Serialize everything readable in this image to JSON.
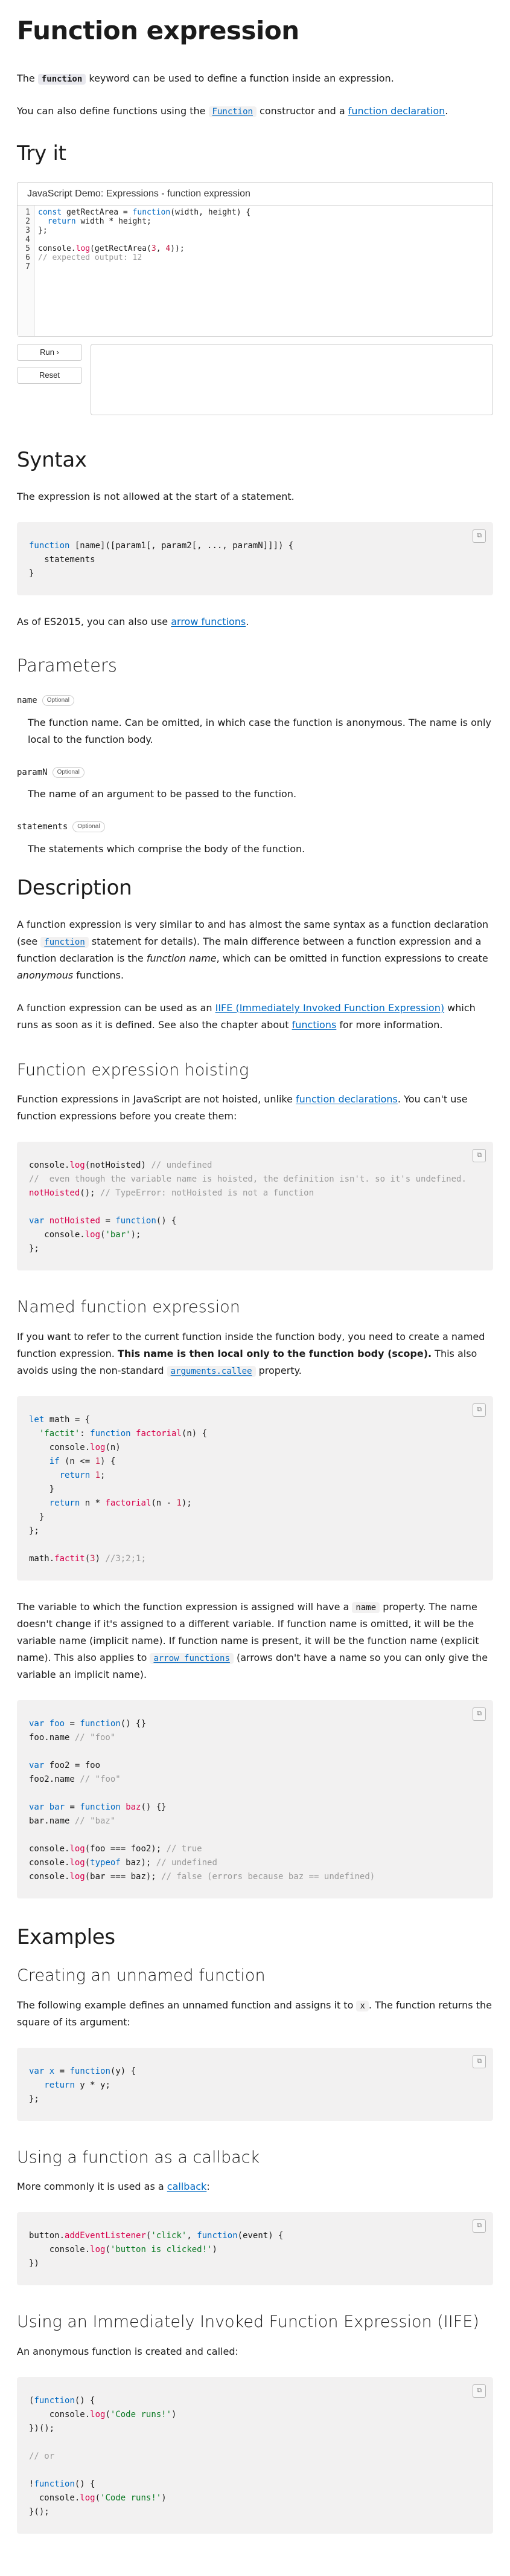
{
  "title": "Function expression",
  "intro": {
    "p1_a": "The ",
    "p1_code": "function",
    "p1_b": " keyword can be used to define a function inside an expression.",
    "p2_a": "You can also define functions using the ",
    "p2_link1": "Function",
    "p2_b": " constructor and a ",
    "p2_link2": "function declaration",
    "p2_c": "."
  },
  "tryit": {
    "heading": "Try it",
    "demo_title": "JavaScript Demo: Expressions - function expression",
    "gutter": "1\n2\n3\n4\n5\n6\n7",
    "run_label": "Run ›",
    "reset_label": "Reset"
  },
  "syntax": {
    "heading": "Syntax",
    "note": "The expression is not allowed at the start of a statement.",
    "after_a": "As of ES2015, you can also use ",
    "after_link": "arrow functions",
    "after_b": "."
  },
  "parameters": {
    "heading": "Parameters",
    "optional_label": "Optional",
    "items": [
      {
        "name": "name",
        "desc": "The function name. Can be omitted, in which case the function is anonymous. The name is only local to the function body."
      },
      {
        "name": "paramN",
        "desc": "The name of an argument to be passed to the function."
      },
      {
        "name": "statements",
        "desc": "The statements which comprise the body of the function."
      }
    ]
  },
  "description": {
    "heading": "Description",
    "p1_a": "A function expression is very similar to and has almost the same syntax as a function declaration (see ",
    "p1_code": "function",
    "p1_b": " statement for details). The main difference between a function expression and a function declaration is the ",
    "p1_em1": "function name",
    "p1_c": ", which can be omitted in function expressions to create ",
    "p1_em2": "anonymous",
    "p1_d": " functions.",
    "p2_a": "A function expression can be used as an ",
    "p2_link1": "IIFE (Immediately Invoked Function Expression)",
    "p2_b": " which runs as soon as it is defined. See also the chapter about ",
    "p2_link2": "functions",
    "p2_c": " for more information."
  },
  "hoisting": {
    "heading": "Function expression hoisting",
    "p_a": "Function expressions in JavaScript are not hoisted, unlike ",
    "p_link": "function declarations",
    "p_b": ". You can't use function expressions before you create them:"
  },
  "named": {
    "heading": "Named function expression",
    "p_a": "If you want to refer to the current function inside the function body, you need to create a named function expression. ",
    "p_strong": "This name is then local only to the function body (scope).",
    "p_b": " This also avoids using the non-standard ",
    "p_link": "arguments.callee",
    "p_c": " property.",
    "p2_a": "The variable to which the function expression is assigned will have a ",
    "p2_code": "name",
    "p2_b": " property. The name doesn't change if it's assigned to a different variable. If function name is omitted, it will be the variable name (implicit name). If function name is present, it will be the function name (explicit name). This also applies to ",
    "p2_link": "arrow functions",
    "p2_c": " (arrows don't have a name so you can only give the variable an implicit name)."
  },
  "examples": {
    "heading": "Examples",
    "unnamed_heading": "Creating an unnamed function",
    "unnamed_p_a": "The following example defines an unnamed function and assigns it to ",
    "unnamed_p_code": "x",
    "unnamed_p_b": ". The function returns the square of its argument:",
    "callback_heading": "Using a function as a callback",
    "callback_p_a": "More commonly it is used as a ",
    "callback_p_link": "callback",
    "callback_p_b": ":",
    "iife_heading": "Using an Immediately Invoked Function Expression (IIFE)",
    "iife_p": "An anonymous function is created and called:"
  },
  "copy_icon": "copy-icon"
}
